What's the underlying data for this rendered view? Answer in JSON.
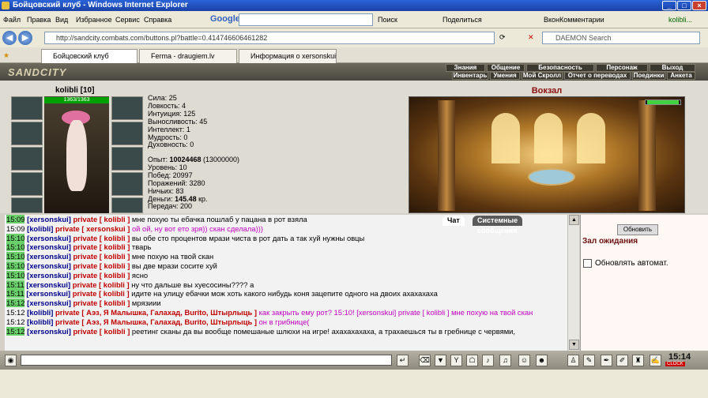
{
  "window": {
    "title": "Бойцовский клуб - Windows Internet Explorer",
    "user": "kolibli..."
  },
  "menu": {
    "file": "Файл",
    "edit": "Правка",
    "view": "Вид",
    "favorites": "Избранное",
    "tools": "Сервис",
    "help": "Справка"
  },
  "toolbar": {
    "google": "Google",
    "search": "Поиск",
    "share": "Поделиться",
    "vk": "ВконКомментарии"
  },
  "address": {
    "url": "http://sandcity.combats.com/buttons.pl?battle=0.414746606461282",
    "search_placeholder": "DAEMON Search"
  },
  "tabs": [
    {
      "label": "Бойцовский клуб"
    },
    {
      "label": "Ferma - draugiem.lv"
    },
    {
      "label": "Информация о xersonskui"
    }
  ],
  "game": {
    "logo": "SANDCITY",
    "nav_top": [
      "Знания",
      "Общение",
      "Безопасность",
      "Персонаж",
      "Выход"
    ],
    "nav_bottom": [
      "Инвентарь",
      "Умения",
      "Мой Скролл",
      "Отчет о переводах",
      "Поединки",
      "Анкета"
    ]
  },
  "character": {
    "name": "kolibli [10]",
    "hp": "1363/1363",
    "stats": [
      "Сила: 25",
      "Ловкость: 4",
      "Интуиция: 125",
      "Выносливость: 45",
      "Интеллект: 1",
      "Мудрость: 0",
      "Духовность: 0"
    ],
    "exp_label": "Опыт: ",
    "exp_value": "10024468",
    "exp_next": " (13000000)",
    "level": "Уровень: 10",
    "wins": "Побед: 20997",
    "losses": "Поражений: 3280",
    "draws": "Ничьих: 83",
    "money_label": "Деньги: ",
    "money_value": "145.48",
    "money_unit": " кр.",
    "transfers": "Передач: 200"
  },
  "location": {
    "name": "Вокзал"
  },
  "chat_tabs": {
    "chat": "Чат",
    "system": "Системные сообщения"
  },
  "chat": [
    {
      "time": "15:09",
      "hl": true,
      "nick": "[xersonskui]",
      "priv": "private [ kolibli ]",
      "text": " мне похую ты ебачка пошлаб у пацана в рот взяла",
      "pink": false
    },
    {
      "time": "15:09",
      "hl": false,
      "nick": "[kolibli]",
      "priv": "private [ xersonskui ]",
      "text": " ой ой, ну вот ето зря)) скан сделала)))",
      "pink": true
    },
    {
      "time": "15:10",
      "hl": true,
      "nick": "[xersonskui]",
      "priv": "private [ kolibli ]",
      "text": " вы обе сто процентов мрази чиста в рот дать а так хуй нужны овцы",
      "pink": false
    },
    {
      "time": "15:10",
      "hl": true,
      "nick": "[xersonskui]",
      "priv": "private [ kolibli ]",
      "text": " тварь",
      "pink": false
    },
    {
      "time": "15:10",
      "hl": true,
      "nick": "[xersonskui]",
      "priv": "private [ kolibli ]",
      "text": " мне похую на твой скан",
      "pink": false
    },
    {
      "time": "15:10",
      "hl": true,
      "nick": "[xersonskui]",
      "priv": "private [ kolibli ]",
      "text": " вы две мрази сосите хуй",
      "pink": false
    },
    {
      "time": "15:10",
      "hl": true,
      "nick": "[xersonskui]",
      "priv": "private [ kolibli ]",
      "text": " ясно",
      "pink": false
    },
    {
      "time": "15:11",
      "hl": true,
      "nick": "[xersonskui]",
      "priv": "private [ kolibli ]",
      "text": " ну что дальше вы хуесосины???? а",
      "pink": false
    },
    {
      "time": "15:11",
      "hl": true,
      "nick": "[xersonskui]",
      "priv": "private [ kolibli ]",
      "text": " идите на улицу ебачки мож хоть какого нибудь коня зацепите одного на двоих ахахахаха",
      "pink": false
    },
    {
      "time": "15:12",
      "hl": true,
      "nick": "[xersonskui]",
      "priv": "private [ kolibli ]",
      "text": " мрязиии",
      "pink": false
    },
    {
      "time": "15:12",
      "hl": false,
      "nick": "[kolibli]",
      "priv": "private [ Аэз, Я Малышка, Галахад, Burito, Штырлыць ]",
      "text": " как закрыть ему рот? 15:10! [xersonskui] private [ kolibli ] мне похую на твой скан",
      "pink": true
    },
    {
      "time": "15:12",
      "hl": false,
      "nick": "[kolibli]",
      "priv": "private [ Аэз, Я Малышка, Галахад, Burito, Штырлыць ]",
      "text": " он в грибнице(",
      "pink": true
    },
    {
      "time": "15:12",
      "hl": true,
      "nick": "[xersonskui]",
      "priv": "private [ kolibli ]",
      "text": " реетинг сканы да вы вообще помешаные шлюхи на игре! ахахахахаха, а трахаешься ты в гребнице с червями,",
      "pink": false
    }
  ],
  "side": {
    "refresh": "Обновить",
    "waiting_room": "Зал ожидания",
    "auto_refresh": "Обновлять автомат."
  },
  "clock": {
    "time": "15:14",
    "label": "CLOCK"
  }
}
